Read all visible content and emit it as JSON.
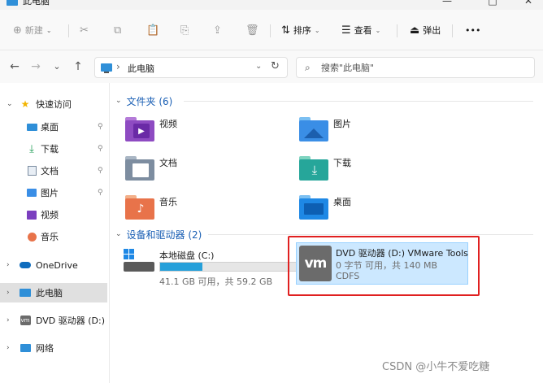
{
  "window": {
    "title": "此电脑",
    "minimize": "—",
    "maximize": "□",
    "close": "✕"
  },
  "commands": {
    "new": {
      "label": "新建",
      "icon": "⊕"
    },
    "cut_icon": "✂",
    "copy_icon": "⧉",
    "paste_icon": "📋",
    "rename_icon": "⎘",
    "share_icon": "⇪",
    "delete_icon": "🗑",
    "sort": {
      "label": "排序",
      "icon": "⇅"
    },
    "view": {
      "label": "查看",
      "icon": "☰"
    },
    "eject": {
      "label": "弹出",
      "icon": "⏏"
    },
    "more": "•••"
  },
  "nav": {
    "back": "←",
    "forward": "→",
    "history": "⌄",
    "up": "↑"
  },
  "address": {
    "separator": "›",
    "location": "此电脑",
    "dropdown": "⌄",
    "refresh": "↻"
  },
  "search": {
    "icon": "⌕",
    "placeholder": "搜索\"此电脑\""
  },
  "sidebar": {
    "quick_access": "快速访问",
    "items": [
      {
        "label": "桌面",
        "pinned": true
      },
      {
        "label": "下载",
        "pinned": true
      },
      {
        "label": "文档",
        "pinned": true
      },
      {
        "label": "图片",
        "pinned": true
      },
      {
        "label": "视频",
        "pinned": false
      },
      {
        "label": "音乐",
        "pinned": false
      }
    ],
    "onedrive": "OneDrive",
    "this_pc": "此电脑",
    "dvd": "DVD 驱动器 (D:) VMware Tools",
    "network": "网络",
    "pin_glyph": "📌"
  },
  "groups": {
    "folders_header": "文件夹 (6)",
    "drives_header": "设备和驱动器 (2)"
  },
  "folders": [
    {
      "label": "视频"
    },
    {
      "label": "图片"
    },
    {
      "label": "文档"
    },
    {
      "label": "下载"
    },
    {
      "label": "音乐"
    },
    {
      "label": "桌面"
    }
  ],
  "drives": {
    "c": {
      "name": "本地磁盘 (C:)",
      "free_text": "41.1 GB 可用，共 59.2 GB",
      "used_fraction": 0.306
    },
    "d": {
      "name": "DVD 驱动器 (D:) VMware Tools",
      "free_text": "0 字节 可用，共 140 MB",
      "fs": "CDFS",
      "logo": "vm"
    }
  },
  "watermark": "CSDN @小牛不爱吃糖",
  "colors": {
    "accent": "#1a5fb4",
    "selection": "#cce8ff",
    "highlight_box": "#e02020",
    "bar_fill": "#26a0da"
  }
}
